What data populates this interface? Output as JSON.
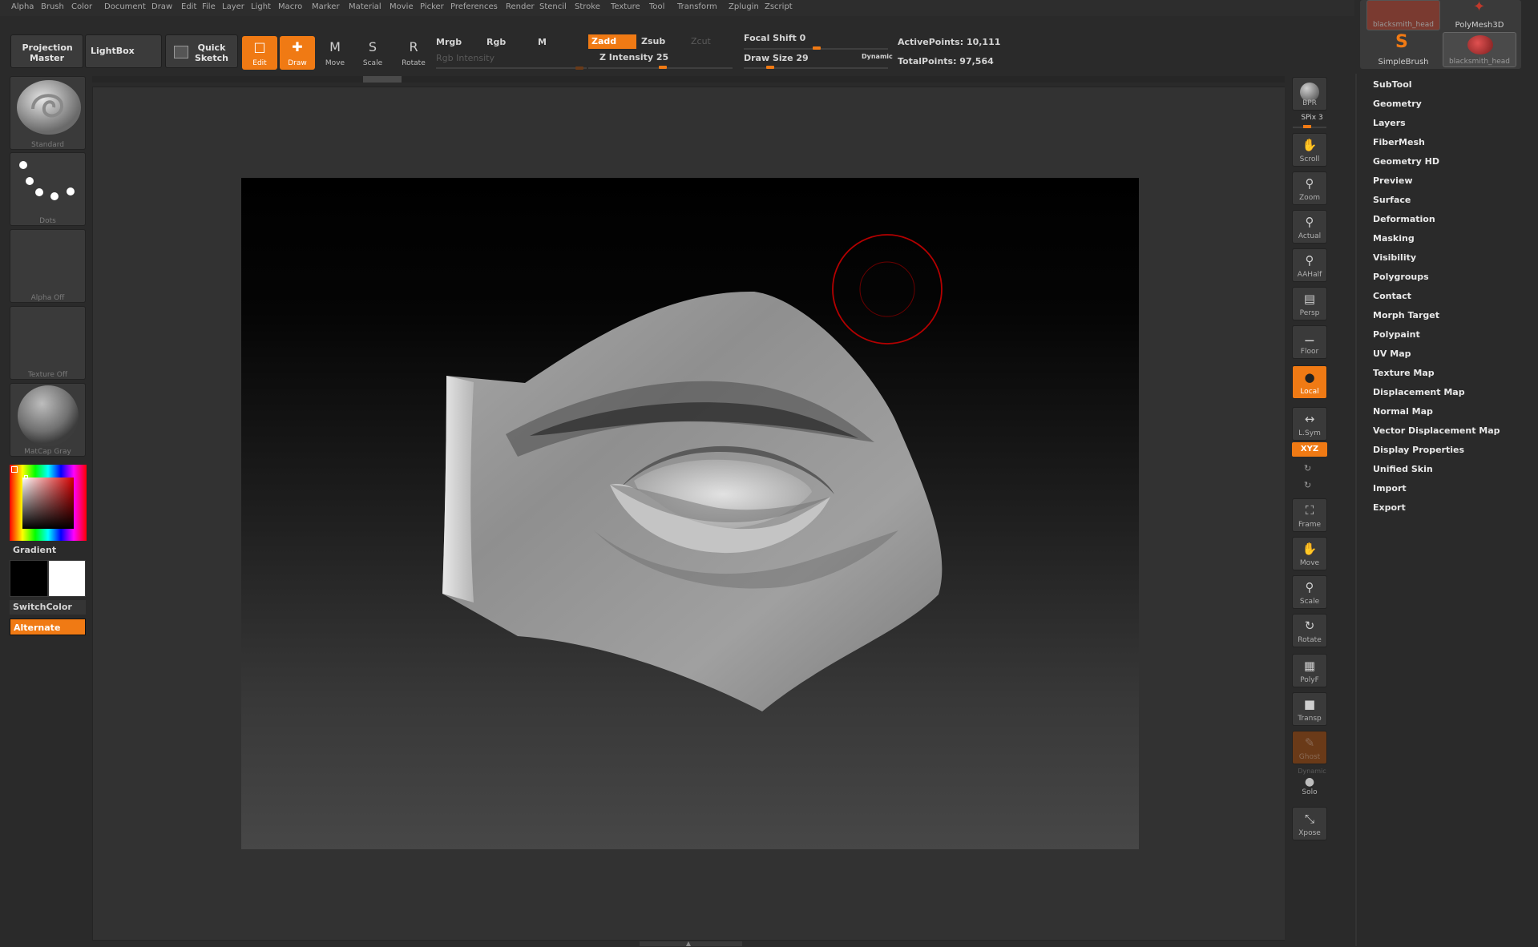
{
  "menu": [
    "Alpha",
    "Brush",
    "Color",
    "Document",
    "Draw",
    "Edit",
    "File",
    "Layer",
    "Light",
    "Macro",
    "Marker",
    "Material",
    "Movie",
    "Picker",
    "Preferences",
    "Render",
    "Stencil",
    "Stroke",
    "Texture",
    "Tool",
    "Transform",
    "Zplugin",
    "Zscript"
  ],
  "toolbar": {
    "projection_master": "Projection Master",
    "lightbox": "LightBox",
    "quick_sketch": "Quick Sketch",
    "tools": [
      {
        "label": "Edit",
        "icon": "edit-icon",
        "active": true
      },
      {
        "label": "Draw",
        "icon": "draw-icon",
        "active": true
      },
      {
        "label": "Move",
        "icon": "move-icon",
        "active": false
      },
      {
        "label": "Scale",
        "icon": "scale-icon",
        "active": false
      },
      {
        "label": "Rotate",
        "icon": "rotate-icon",
        "active": false
      }
    ],
    "mrgb": "Mrgb",
    "rgb": "Rgb",
    "m": "M",
    "rgb_intensity": "Rgb Intensity",
    "zadd": "Zadd",
    "zsub": "Zsub",
    "zcut": "Zcut",
    "z_intensity": "Z Intensity 25",
    "focal_shift": "Focal Shift 0",
    "draw_size": "Draw Size 29",
    "dynamic": "Dynamic",
    "active_points": "ActivePoints: 10,111",
    "total_points": "TotalPoints: 97,564"
  },
  "left_shelf": {
    "brush": "Standard",
    "stroke": "Dots",
    "alpha": "Alpha Off",
    "texture": "Texture Off",
    "material": "MatCap Gray",
    "gradient": "Gradient",
    "switch_color": "SwitchColor",
    "alternate": "Alternate"
  },
  "right_shelf": {
    "bpr": "BPR",
    "spix": "SPix 3",
    "buttons": [
      {
        "label": "Scroll",
        "icon": "scroll-hand-icon"
      },
      {
        "label": "Zoom",
        "icon": "zoom-icon"
      },
      {
        "label": "Actual",
        "icon": "actual-icon"
      },
      {
        "label": "AAHalf",
        "icon": "aahalf-icon"
      },
      {
        "label": "Persp",
        "icon": "persp-icon"
      },
      {
        "label": "Floor",
        "icon": "floor-icon"
      },
      {
        "label": "Local",
        "icon": "local-icon"
      },
      {
        "label": "L.Sym",
        "icon": "lsym-icon"
      },
      {
        "label": "Frame",
        "icon": "frame-icon"
      },
      {
        "label": "Move",
        "icon": "move-icon"
      },
      {
        "label": "Scale",
        "icon": "scale-icon"
      },
      {
        "label": "Rotate",
        "icon": "rotate-icon"
      },
      {
        "label": "PolyF",
        "icon": "polyf-icon"
      },
      {
        "label": "Transp",
        "icon": "transp-icon"
      },
      {
        "label": "Ghost",
        "icon": "ghost-icon"
      },
      {
        "label": "Solo",
        "icon": "solo-icon"
      },
      {
        "label": "Xpose",
        "icon": "xpose-icon"
      }
    ],
    "xyz": "XYZ",
    "dynamic": "Dynamic"
  },
  "tool_thumbs": [
    "blacksmith_head",
    "PolyMesh3D",
    "SimpleBrush",
    "blacksmith_head"
  ],
  "palette": [
    "SubTool",
    "Geometry",
    "Layers",
    "FiberMesh",
    "Geometry HD",
    "Preview",
    "Surface",
    "Deformation",
    "Masking",
    "Visibility",
    "Polygroups",
    "Contact",
    "Morph Target",
    "Polypaint",
    "UV Map",
    "Texture Map",
    "Displacement Map",
    "Normal Map",
    "Vector Displacement Map",
    "Display Properties",
    "Unified Skin",
    "Import",
    "Export"
  ],
  "colors": {
    "accent": "#f07a14",
    "brush_cursor": "#b40000",
    "primary_color": "#000000",
    "secondary_color": "#ffffff"
  }
}
